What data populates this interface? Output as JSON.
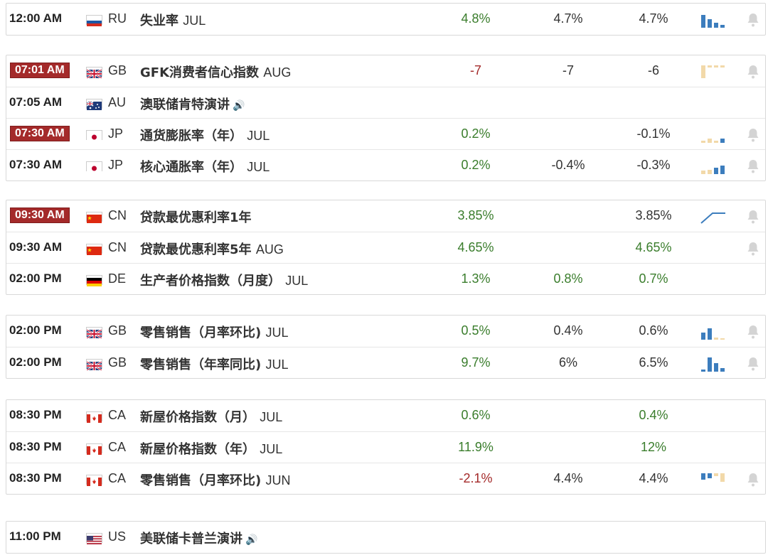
{
  "groups": [
    {
      "rows": [
        {
          "time": "12:00 AM",
          "hl": false,
          "flag": "ru",
          "cc": "RU",
          "event": "失业率",
          "period": "JUL",
          "actual": "4.8%",
          "ac": "up",
          "forecast": "4.7%",
          "previous": "4.7%",
          "pc": "neu",
          "spark": "bars-blue",
          "bell": true,
          "speaker": false
        }
      ]
    },
    {
      "rows": [
        {
          "time": "07:01 AM",
          "hl": true,
          "flag": "gb",
          "cc": "GB",
          "event": "GFK消费者信心指数",
          "period": "AUG",
          "actual": "-7",
          "ac": "down",
          "forecast": "-7",
          "previous": "-6",
          "pc": "neu",
          "spark": "bars-tan",
          "bell": true,
          "speaker": false
        },
        {
          "time": "07:05 AM",
          "hl": false,
          "flag": "au",
          "cc": "AU",
          "event": "澳联储肯特演讲",
          "period": "",
          "actual": "",
          "ac": "neu",
          "forecast": "",
          "previous": "",
          "pc": "neu",
          "spark": "",
          "bell": false,
          "speaker": true
        },
        {
          "time": "07:30 AM",
          "hl": true,
          "flag": "jp",
          "cc": "JP",
          "event": "通货膨胀率（年）",
          "period": "JUL",
          "actual": "0.2%",
          "ac": "up",
          "forecast": "",
          "previous": "-0.1%",
          "pc": "neu",
          "spark": "bars-mixed1",
          "bell": true,
          "speaker": false
        },
        {
          "time": "07:30 AM",
          "hl": false,
          "flag": "jp",
          "cc": "JP",
          "event": "核心通胀率（年）",
          "period": "JUL",
          "actual": "0.2%",
          "ac": "up",
          "forecast": "-0.4%",
          "previous": "-0.3%",
          "pc": "neu",
          "spark": "bars-mixed2",
          "bell": true,
          "speaker": false
        }
      ]
    },
    {
      "rows": [
        {
          "time": "09:30 AM",
          "hl": true,
          "flag": "cn",
          "cc": "CN",
          "event": "贷款最优惠利率1年",
          "period": "",
          "actual": "3.85%",
          "ac": "up",
          "forecast": "",
          "previous": "3.85%",
          "pc": "neu",
          "spark": "line",
          "bell": true,
          "speaker": false
        },
        {
          "time": "09:30 AM",
          "hl": false,
          "flag": "cn",
          "cc": "CN",
          "event": "贷款最优惠利率5年",
          "period": "AUG",
          "actual": "4.65%",
          "ac": "up",
          "forecast": "",
          "previous": "4.65%",
          "pc": "up",
          "spark": "",
          "bell": true,
          "speaker": false
        },
        {
          "time": "02:00 PM",
          "hl": false,
          "flag": "de",
          "cc": "DE",
          "event": "生产者价格指数（月度）",
          "period": "JUL",
          "actual": "1.3%",
          "ac": "up",
          "forecast": "0.8%",
          "fc": "up",
          "previous": "0.7%",
          "pc": "up",
          "spark": "",
          "bell": false,
          "speaker": false
        }
      ]
    },
    {
      "rows": [
        {
          "time": "02:00 PM",
          "hl": false,
          "flag": "gb",
          "cc": "GB",
          "event": "零售销售（月率环比)",
          "period": "JUL",
          "actual": "0.5%",
          "ac": "up",
          "forecast": "0.4%",
          "previous": "0.6%",
          "pc": "neu",
          "spark": "bars-mixed3",
          "bell": true,
          "speaker": false
        },
        {
          "time": "02:00 PM",
          "hl": false,
          "flag": "gb",
          "cc": "GB",
          "event": "零售销售（年率同比)",
          "period": "JUL",
          "actual": "9.7%",
          "ac": "up",
          "forecast": "6%",
          "previous": "6.5%",
          "pc": "neu",
          "spark": "bars-blue2",
          "bell": true,
          "speaker": false
        }
      ]
    },
    {
      "rows": [
        {
          "time": "08:30 PM",
          "hl": false,
          "flag": "ca",
          "cc": "CA",
          "event": "新屋价格指数（月）",
          "period": "JUL",
          "actual": "0.6%",
          "ac": "up",
          "forecast": "",
          "previous": "0.4%",
          "pc": "up",
          "spark": "",
          "bell": false,
          "speaker": false
        },
        {
          "time": "08:30 PM",
          "hl": false,
          "flag": "ca",
          "cc": "CA",
          "event": "新屋价格指数（年）",
          "period": "JUL",
          "actual": "11.9%",
          "ac": "up",
          "forecast": "",
          "previous": "12%",
          "pc": "up",
          "spark": "",
          "bell": false,
          "speaker": false
        },
        {
          "time": "08:30 PM",
          "hl": false,
          "flag": "ca",
          "cc": "CA",
          "event": "零售销售（月率环比)",
          "period": "JUN",
          "actual": "-2.1%",
          "ac": "down",
          "forecast": "4.4%",
          "previous": "4.4%",
          "pc": "neu",
          "spark": "bars-mixed4",
          "bell": true,
          "speaker": false
        }
      ]
    },
    {
      "rows": [
        {
          "time": "11:00 PM",
          "hl": false,
          "flag": "us",
          "cc": "US",
          "event": "美联储卡普兰演讲",
          "period": "",
          "actual": "",
          "ac": "neu",
          "forecast": "",
          "previous": "",
          "pc": "neu",
          "spark": "",
          "bell": false,
          "speaker": true
        }
      ]
    }
  ],
  "colors": {
    "up": "#3a7d2c",
    "down": "#a42a2a",
    "highlight": "#a42a2a",
    "spark_blue": "#3c7dbd",
    "spark_tan": "#f2d9a9"
  },
  "icons": {
    "speaker": "speaker-icon",
    "bell": "bell-icon"
  }
}
